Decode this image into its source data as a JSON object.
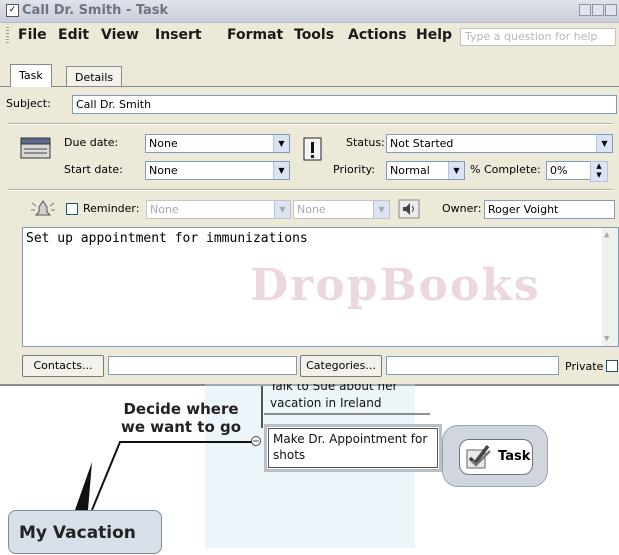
{
  "window": {
    "title": "Call Dr. Smith - Task"
  },
  "menu": {
    "items": [
      "File",
      "Edit",
      "View",
      "Insert",
      "Format",
      "Tools",
      "Actions",
      "Help"
    ],
    "question_placeholder": "Type a question for help"
  },
  "tabs": [
    "Task",
    "Details"
  ],
  "form": {
    "subject_label": "Subject:",
    "subject_value": "Call Dr. Smith",
    "due_date_label": "Due date:",
    "due_date_value": "None",
    "start_date_label": "Start date:",
    "start_date_value": "None",
    "status_label": "Status:",
    "status_value": "Not Started",
    "priority_label": "Priority:",
    "priority_value": "Normal",
    "complete_label": "% Complete:",
    "complete_value": "0%",
    "reminder_label": "Reminder:",
    "reminder_date": "None",
    "reminder_time": "None",
    "owner_label": "Owner:",
    "owner_value": "Roger Voight",
    "notes": "Set up appointment for immunizations",
    "contacts_button": "Contacts...",
    "categories_button": "Categories...",
    "private_label": "Private"
  },
  "watermark": "DropBooks",
  "mindmap": {
    "topic_cut": "Talk to Sue about her",
    "topic_vacation": "vacation in Ireland",
    "decide": "Decide where we want to go",
    "appointment": "Make Dr. Appointment for shots",
    "task_label": "Task",
    "root": "My Vacation"
  }
}
